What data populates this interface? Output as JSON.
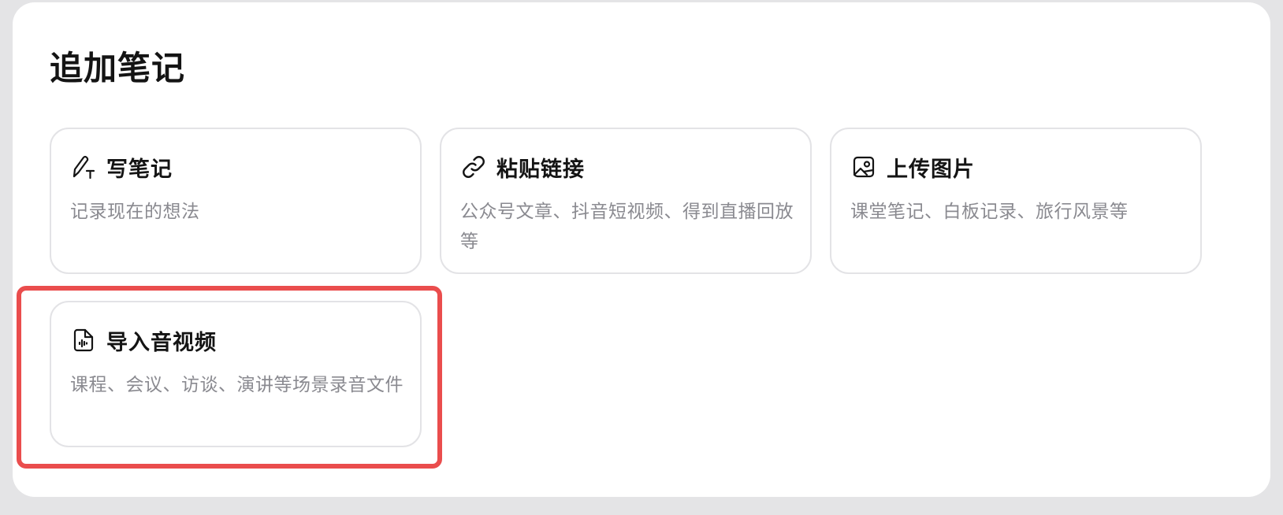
{
  "dialog": {
    "title": "追加笔记"
  },
  "options": [
    {
      "icon": "pen-text-icon",
      "title": "写笔记",
      "description": "记录现在的想法"
    },
    {
      "icon": "link-icon",
      "title": "粘贴链接",
      "description": "公众号文章、抖音短视频、得到直播回放等"
    },
    {
      "icon": "image-icon",
      "title": "上传图片",
      "description": "课堂笔记、白板记录、旅行风景等"
    },
    {
      "icon": "audio-file-icon",
      "title": "导入音视频",
      "description": "课程、会议、访谈、演讲等场景录音文件"
    }
  ],
  "highlight": {
    "color": "#ea4d4d",
    "target": "导入音视频"
  }
}
